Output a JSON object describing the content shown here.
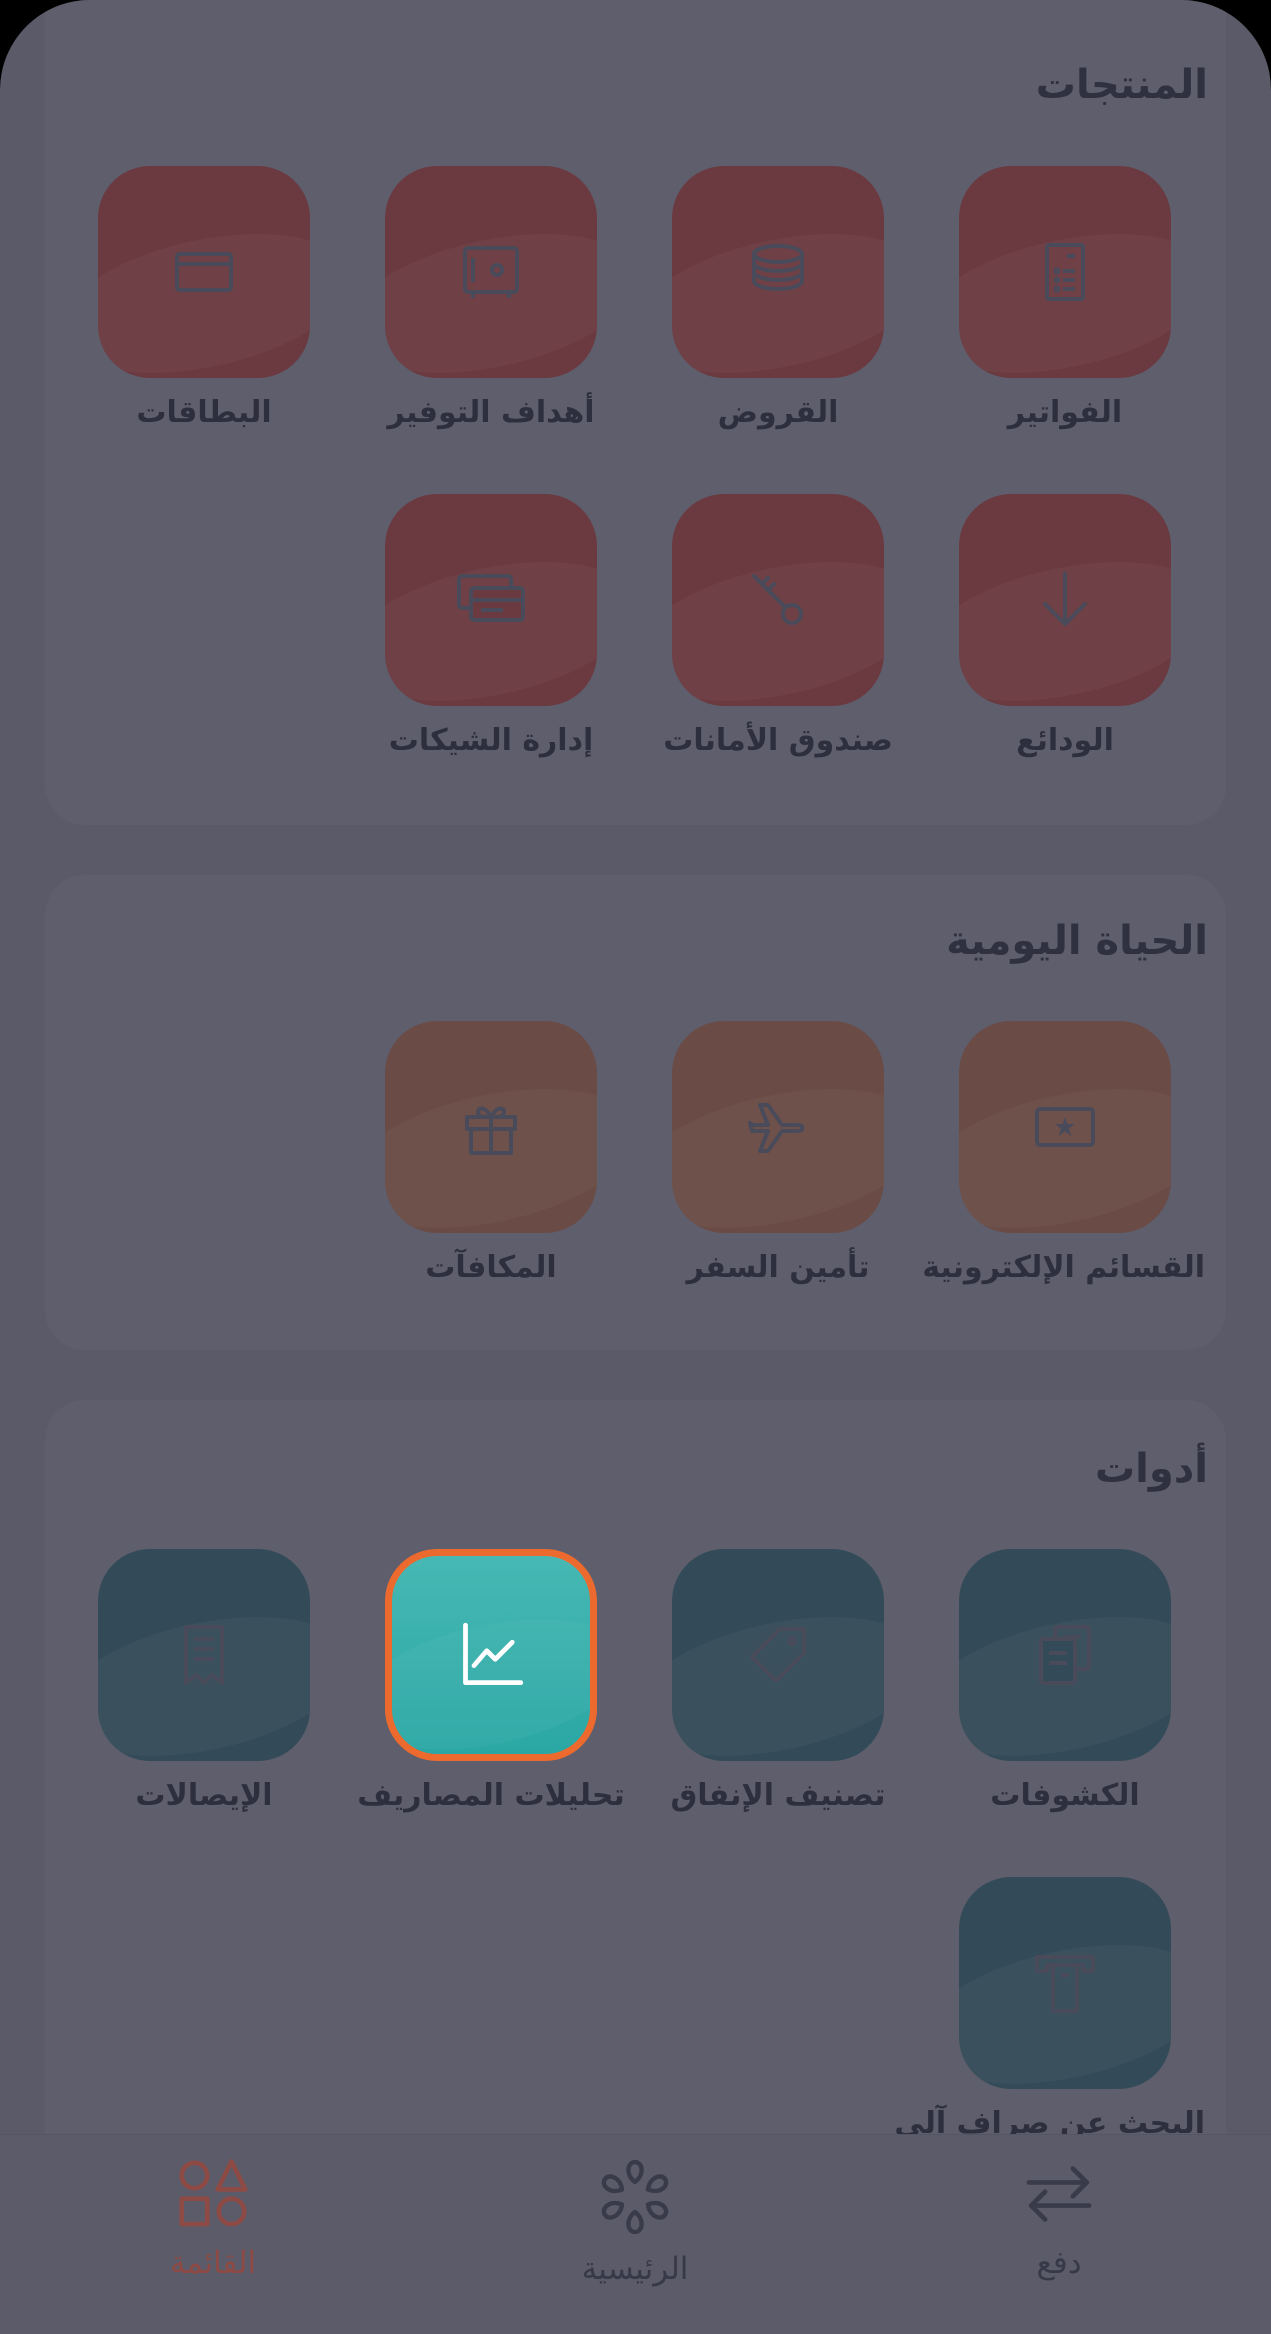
{
  "sections": {
    "products": {
      "title": "المنتجات",
      "items": [
        {
          "label": "الفواتير",
          "icon": "invoice-icon"
        },
        {
          "label": "القروض",
          "icon": "coins-stack-icon"
        },
        {
          "label": "أهداف التوفير",
          "icon": "safe-icon"
        },
        {
          "label": "البطاقات",
          "icon": "card-icon"
        },
        {
          "label": "الودائع",
          "icon": "arrow-down-icon"
        },
        {
          "label": "صندوق الأمانات",
          "icon": "key-icon"
        },
        {
          "label": "إدارة الشيكات",
          "icon": "cheques-icon"
        }
      ]
    },
    "daily_life": {
      "title": "الحياة اليومية",
      "items": [
        {
          "label": "القسائم الإلكترونية",
          "icon": "voucher-icon"
        },
        {
          "label": "تأمين السفر",
          "icon": "airplane-icon"
        },
        {
          "label": "المكافآت",
          "icon": "gift-icon"
        }
      ]
    },
    "tools": {
      "title": "أدوات",
      "items": [
        {
          "label": "الكشوفات",
          "icon": "statements-icon"
        },
        {
          "label": "تصنيف الإنفاق",
          "icon": "tag-icon"
        },
        {
          "label": "تحليلات المصاريف",
          "icon": "line-chart-icon"
        },
        {
          "label": "الإيصالات",
          "icon": "receipt-icon"
        },
        {
          "label": "البحث عن صراف آلي",
          "icon": "atm-icon"
        }
      ]
    }
  },
  "bottom_nav": {
    "items": [
      {
        "label": "دفع",
        "icon": "transfer-arrows-icon"
      },
      {
        "label": "الرئيسية",
        "icon": "home-logo-icon"
      },
      {
        "label": "القائمة",
        "icon": "shapes-menu-icon"
      }
    ],
    "active": "القائمة"
  },
  "colors": {
    "highlight_border": "#ec6a2e",
    "highlight_tile": "#2aa7a4",
    "active_nav": "#8e4a45",
    "products_tile": "#6a3a40",
    "daily_tile": "#6a4b45",
    "tools_tile": "#334b58"
  }
}
